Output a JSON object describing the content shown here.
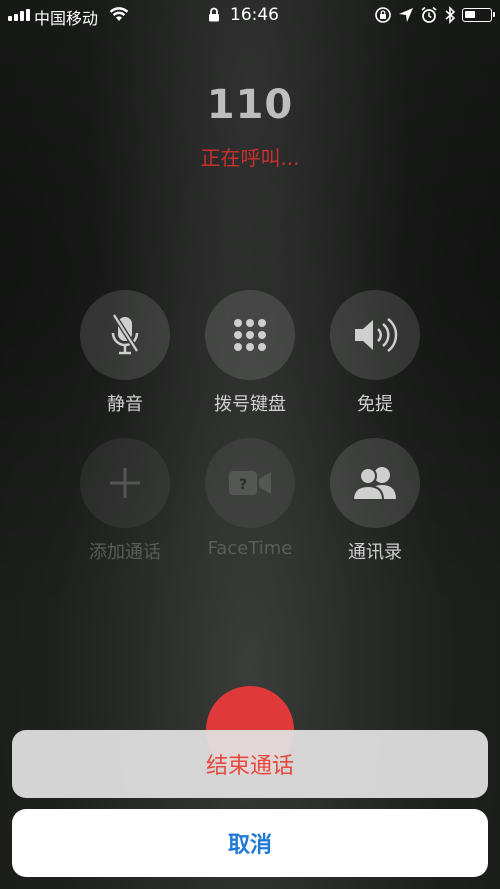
{
  "status_bar": {
    "carrier": "中国移动",
    "time": "16:46",
    "signal_bars": 4,
    "battery_level": 0.45,
    "icons": [
      "wifi-icon",
      "lock-icon",
      "rotation-lock-icon",
      "location-icon",
      "alarm-icon",
      "bluetooth-icon",
      "battery-icon"
    ]
  },
  "call": {
    "number": "110",
    "status": "正在呼叫..."
  },
  "controls": [
    {
      "label": "静音",
      "icon": "mute-microphone-icon",
      "enabled": true
    },
    {
      "label": "拨号键盘",
      "icon": "keypad-icon",
      "enabled": true
    },
    {
      "label": "免提",
      "icon": "speaker-icon",
      "enabled": true
    },
    {
      "label": "添加通话",
      "icon": "add-call-icon",
      "enabled": false
    },
    {
      "label": "FaceTime",
      "icon": "facetime-icon",
      "enabled": false
    },
    {
      "label": "通讯录",
      "icon": "contacts-icon",
      "enabled": true
    }
  ],
  "action_sheet": {
    "end_call_label": "结束通话",
    "cancel_label": "取消"
  },
  "colors": {
    "end_call_red": "#e64a3f",
    "cancel_blue": "#1f7ad6",
    "status_red": "#c9302c"
  }
}
